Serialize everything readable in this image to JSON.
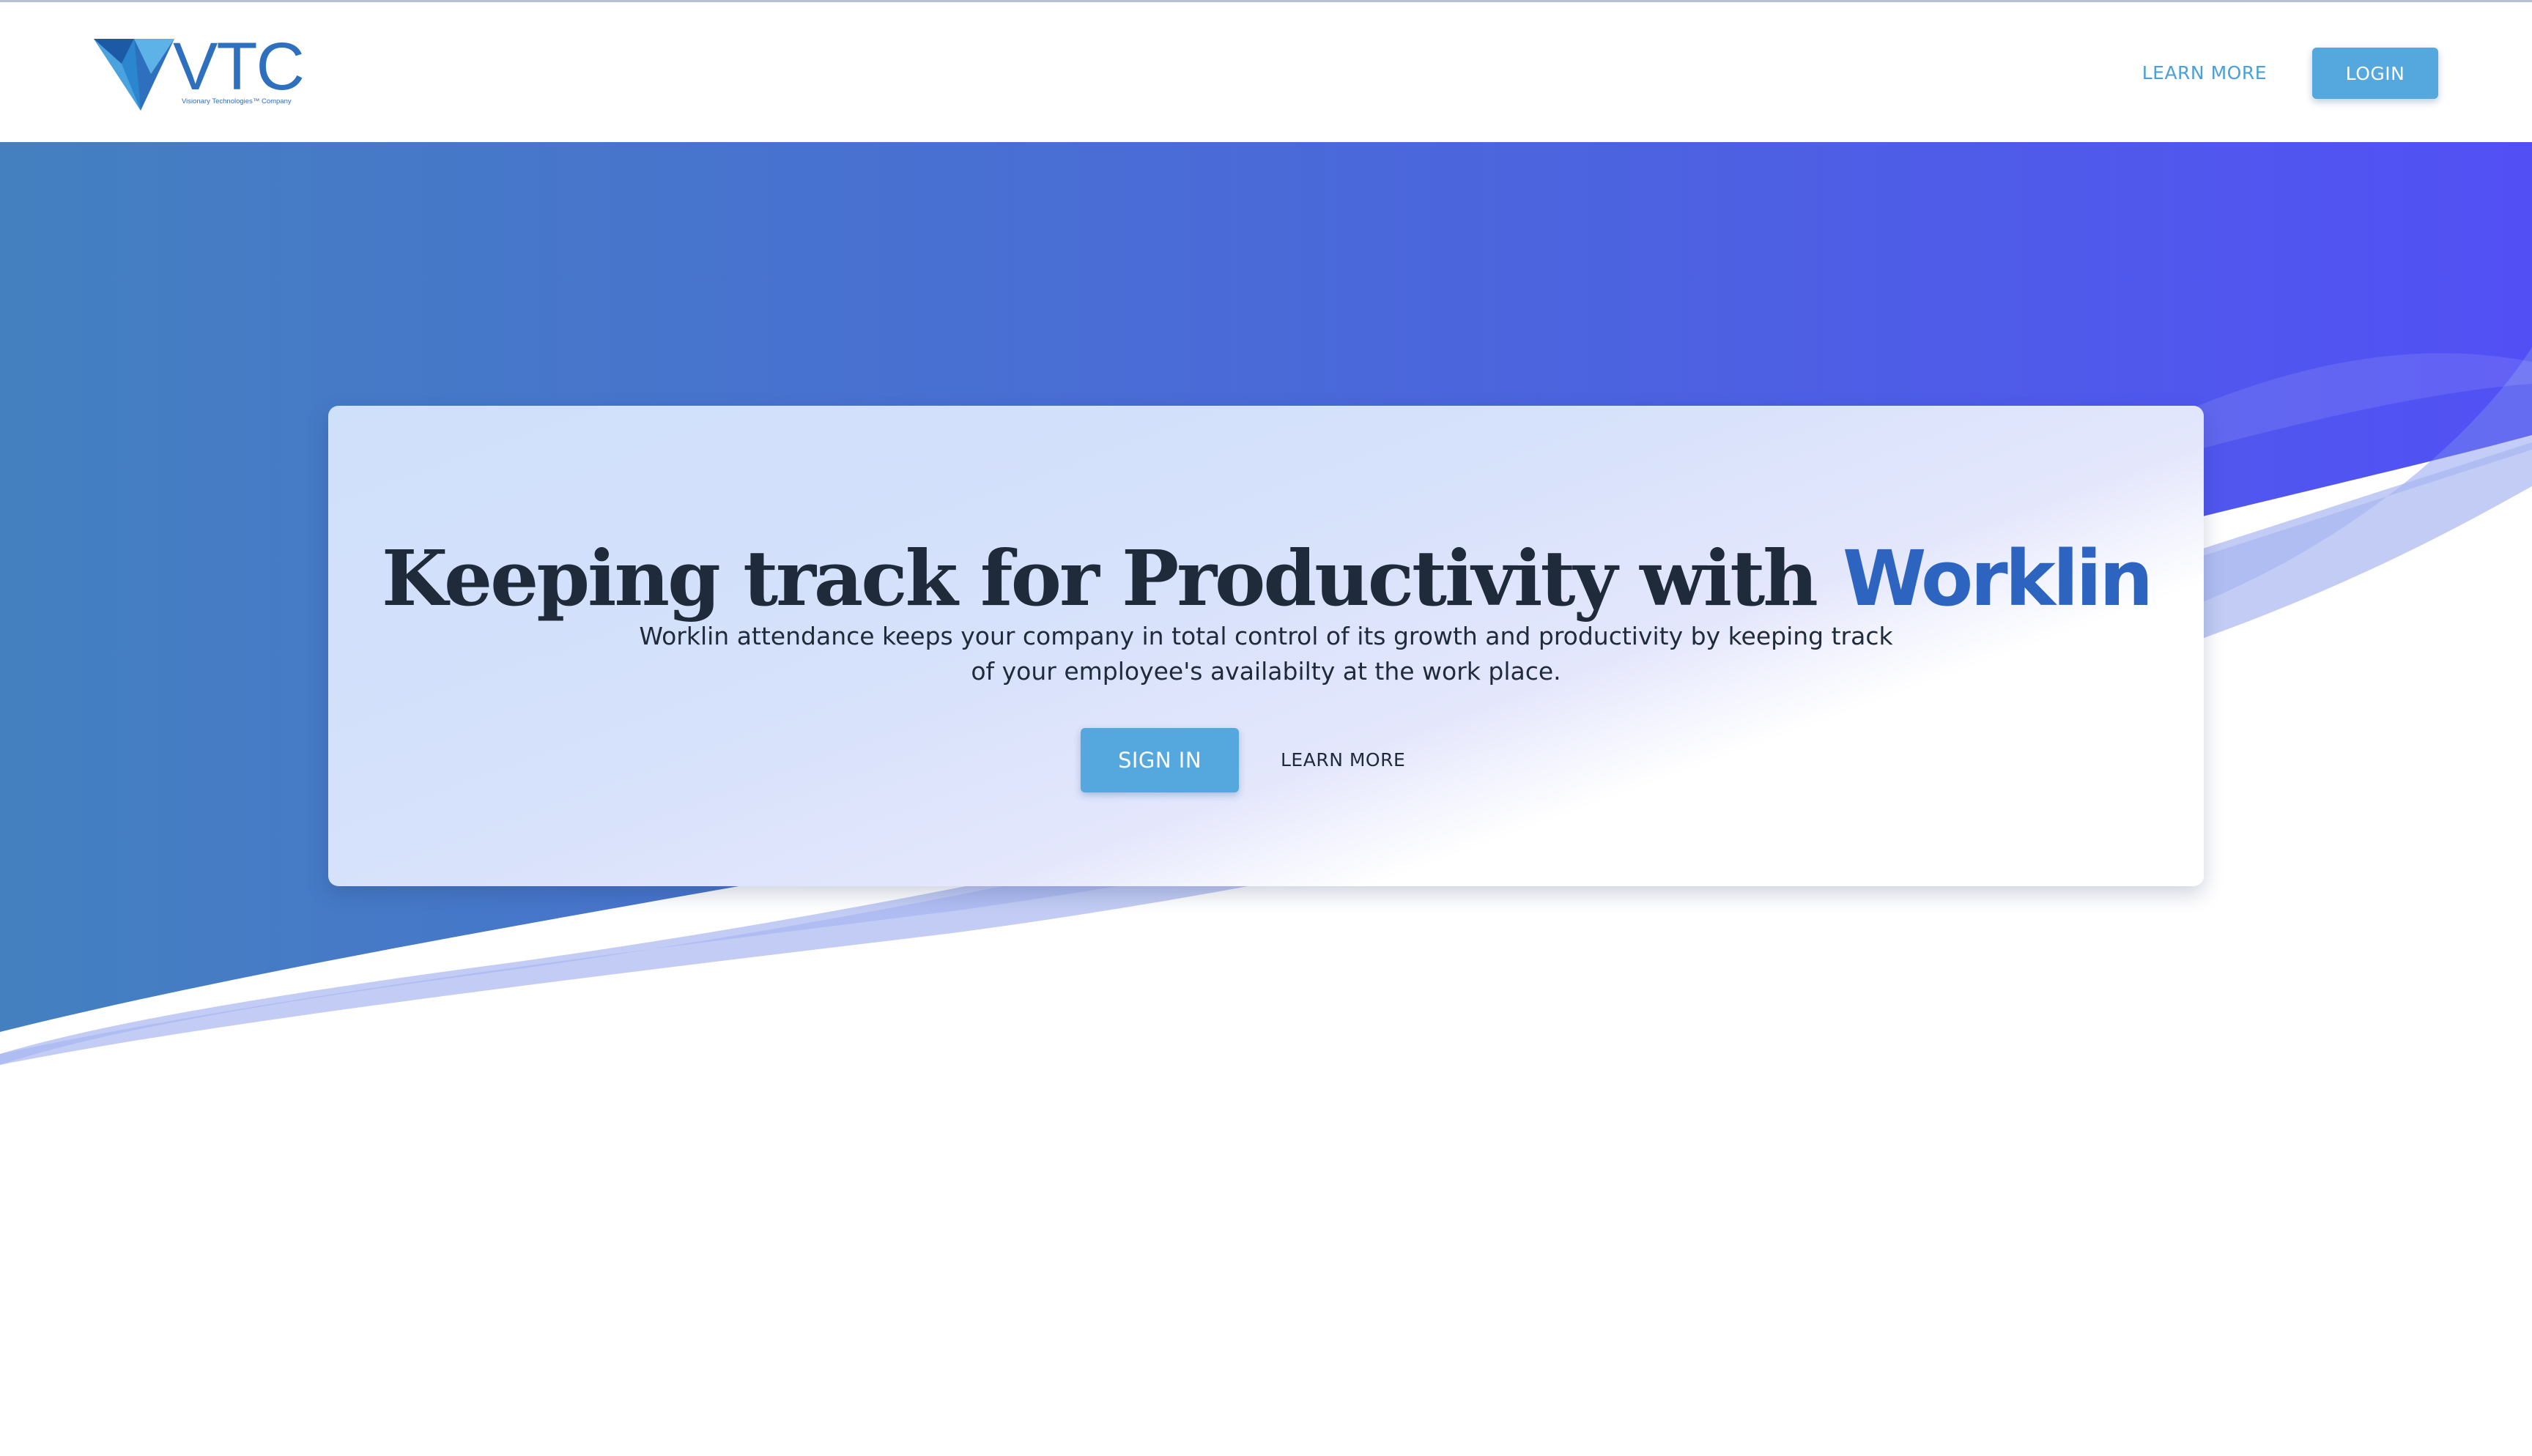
{
  "header": {
    "logo": {
      "text": "VTC",
      "tagline": "Visionary Technologies™ Company"
    },
    "nav": {
      "learn_more_label": "LEARN MORE",
      "login_label": "LOGIN"
    }
  },
  "hero": {
    "title": "Keeping track for Productivity with",
    "brand": "Worklin",
    "description": "Worklin attendance keeps your company in total control of its growth and productivity by keeping track of your employee's availabilty at the work place.",
    "sign_in_label": "SIGN IN",
    "learn_more_label": "LEARN MORE"
  },
  "colors": {
    "brand_blue": "#2d64c0",
    "button_blue": "#55a8de",
    "gradient_start": "#4480c0",
    "gradient_end": "#5250f5"
  }
}
